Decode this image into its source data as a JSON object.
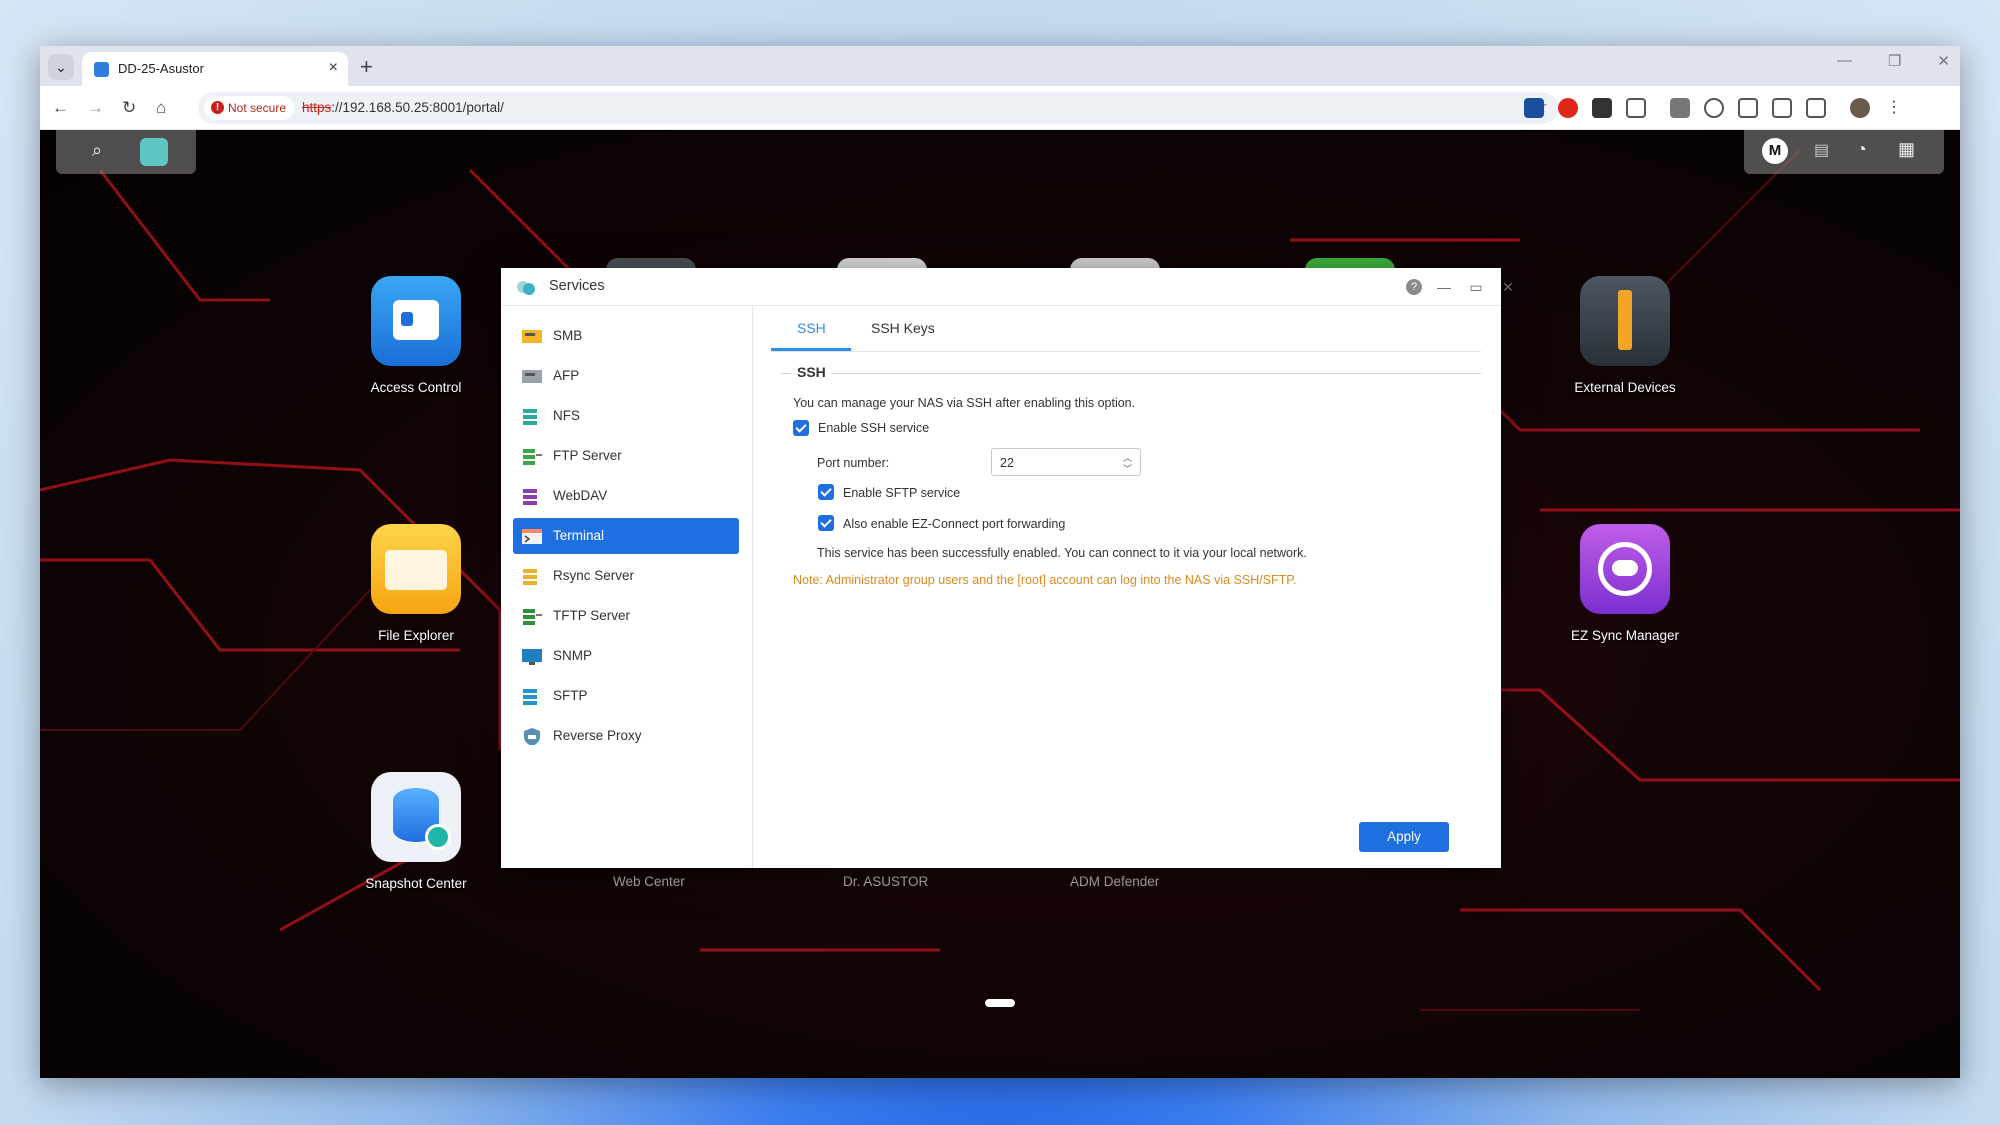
{
  "browser": {
    "tab_title": "DD-25-Asustor",
    "new_tab": "+",
    "not_secure": "Not secure",
    "url_scheme": "https",
    "url_rest": "://192.168.50.25:8001/portal/"
  },
  "desktop": {
    "apps_left": [
      {
        "label": "Access Control"
      },
      {
        "label": "File Explorer"
      },
      {
        "label": "Snapshot Center"
      }
    ],
    "apps_right": [
      {
        "label": "External Devices"
      },
      {
        "label": "EZ Sync Manager"
      }
    ],
    "ghost_labels": [
      "Web Center",
      "Dr. ASUSTOR",
      "ADM Defender"
    ],
    "user_initial": "M"
  },
  "dialog": {
    "title": "Services",
    "sidebar": [
      {
        "label": "SMB"
      },
      {
        "label": "AFP"
      },
      {
        "label": "NFS"
      },
      {
        "label": "FTP Server"
      },
      {
        "label": "WebDAV"
      },
      {
        "label": "Terminal"
      },
      {
        "label": "Rsync Server"
      },
      {
        "label": "TFTP Server"
      },
      {
        "label": "SNMP"
      },
      {
        "label": "SFTP"
      },
      {
        "label": "Reverse Proxy"
      }
    ],
    "active_item": "Terminal",
    "tabs": [
      {
        "label": "SSH"
      },
      {
        "label": "SSH Keys"
      }
    ],
    "active_tab": "SSH",
    "section_title": "SSH",
    "description": "You can manage your NAS via SSH after enabling this option.",
    "enable_ssh": {
      "label": "Enable SSH service",
      "checked": true
    },
    "port_label": "Port number:",
    "port_value": "22",
    "enable_sftp": {
      "label": "Enable SFTP service",
      "checked": true
    },
    "ez_connect": {
      "label": "Also enable EZ-Connect port forwarding",
      "checked": true
    },
    "status": "This service has been successfully enabled. You can connect to it via your local network.",
    "note": "Note: Administrator group users and the [root] account can log into the NAS via SSH/SFTP.",
    "apply": "Apply"
  },
  "colors": {
    "accent": "#1e6fe0",
    "tab_accent": "#2f8ee5",
    "note": "#d98b1f",
    "desktop_bg": "#120405",
    "circuit_red": "#c0141c"
  }
}
